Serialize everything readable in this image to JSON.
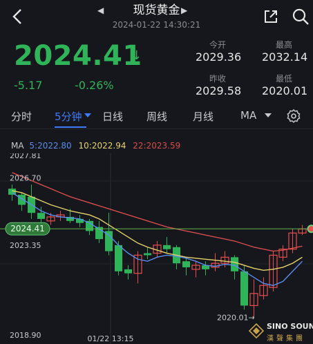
{
  "header": {
    "title": "现货黄金",
    "datetime": "2024-01-22 14:30:21",
    "back_icon": "chevron-left-icon",
    "share_icon": "share-icon",
    "search_icon": "search-icon"
  },
  "quote": {
    "price": "2024.41",
    "change": "-5.17",
    "change_pct": "-0.26%",
    "trend_icon": "down-arrow-icon",
    "open_label": "今开",
    "open": "2029.36",
    "high_label": "最高",
    "high": "2032.14",
    "prev_close_label": "昨收",
    "prev_close": "2029.58",
    "low_label": "最低",
    "low": "2020.01",
    "up_color": "#e84e4e",
    "down_color": "#2fb45a"
  },
  "tabs": [
    {
      "label": "分时",
      "active": false
    },
    {
      "label": "5分钟",
      "active": true
    },
    {
      "label": "日线",
      "active": false
    },
    {
      "label": "周线",
      "active": false
    },
    {
      "label": "月线",
      "active": false
    },
    {
      "label": "MA",
      "active": false
    }
  ],
  "settings_icon": "gear-icon",
  "ma_legend": {
    "label": "MA",
    "ma5": "5:2022.80",
    "ma10": "10:2022.94",
    "ma22": "22:2023.59",
    "ma5_color": "#5b8def",
    "ma10_color": "#e6d26b",
    "ma22_color": "#d64c4c"
  },
  "chart_data": {
    "type": "candlestick",
    "y_labels": [
      "2027.81",
      "2026.70",
      "2023.35",
      "2018.90"
    ],
    "x_label": "01/22 13:15",
    "current_price_tag": "2024.41",
    "low_annotation": "2020.01→",
    "ylim": [
      2018.9,
      2027.81
    ],
    "candles": [
      {
        "o": 2026.4,
        "c": 2026.1,
        "h": 2026.6,
        "l": 2025.8
      },
      {
        "o": 2026.1,
        "c": 2025.6,
        "h": 2026.2,
        "l": 2025.3
      },
      {
        "o": 2026.0,
        "c": 2025.2,
        "h": 2026.6,
        "l": 2024.9
      },
      {
        "o": 2025.2,
        "c": 2024.9,
        "h": 2025.5,
        "l": 2024.7
      },
      {
        "o": 2024.8,
        "c": 2025.0,
        "h": 2025.2,
        "l": 2024.6
      },
      {
        "o": 2025.0,
        "c": 2025.1,
        "h": 2025.3,
        "l": 2024.8
      },
      {
        "o": 2025.0,
        "c": 2024.8,
        "h": 2025.4,
        "l": 2024.7
      },
      {
        "o": 2024.9,
        "c": 2024.7,
        "h": 2025.1,
        "l": 2024.5
      },
      {
        "o": 2024.8,
        "c": 2024.3,
        "h": 2024.9,
        "l": 2024.1
      },
      {
        "o": 2024.5,
        "c": 2023.9,
        "h": 2024.8,
        "l": 2023.7
      },
      {
        "o": 2024.3,
        "c": 2023.3,
        "h": 2025.2,
        "l": 2023.1
      },
      {
        "o": 2023.6,
        "c": 2022.3,
        "h": 2023.8,
        "l": 2022.1
      },
      {
        "o": 2022.4,
        "c": 2022.2,
        "h": 2022.6,
        "l": 2021.9
      },
      {
        "o": 2022.2,
        "c": 2023.1,
        "h": 2023.3,
        "l": 2021.7
      },
      {
        "o": 2023.2,
        "c": 2023.1,
        "h": 2023.5,
        "l": 2022.9
      },
      {
        "o": 2023.2,
        "c": 2023.6,
        "h": 2023.8,
        "l": 2023.0
      },
      {
        "o": 2023.6,
        "c": 2023.4,
        "h": 2024.0,
        "l": 2023.2
      },
      {
        "o": 2023.5,
        "c": 2022.7,
        "h": 2023.6,
        "l": 2022.4
      },
      {
        "o": 2022.8,
        "c": 2022.5,
        "h": 2023.0,
        "l": 2022.1
      },
      {
        "o": 2022.4,
        "c": 2022.6,
        "h": 2022.8,
        "l": 2022.0
      },
      {
        "o": 2022.6,
        "c": 2022.4,
        "h": 2022.8,
        "l": 2022.1
      },
      {
        "o": 2022.5,
        "c": 2022.7,
        "h": 2023.2,
        "l": 2022.3
      },
      {
        "o": 2022.7,
        "c": 2023.0,
        "h": 2023.3,
        "l": 2022.5
      },
      {
        "o": 2023.0,
        "c": 2022.3,
        "h": 2023.1,
        "l": 2021.9
      },
      {
        "o": 2022.3,
        "c": 2020.6,
        "h": 2022.6,
        "l": 2020.4
      },
      {
        "o": 2020.6,
        "c": 2021.2,
        "h": 2021.9,
        "l": 2020.01
      },
      {
        "o": 2021.1,
        "c": 2021.6,
        "h": 2022.0,
        "l": 2020.9
      },
      {
        "o": 2021.5,
        "c": 2023.1,
        "h": 2023.3,
        "l": 2021.3
      },
      {
        "o": 2023.0,
        "c": 2023.4,
        "h": 2023.6,
        "l": 2022.8
      },
      {
        "o": 2023.4,
        "c": 2024.2,
        "h": 2024.4,
        "l": 2023.2
      },
      {
        "o": 2024.2,
        "c": 2024.4,
        "h": 2024.6,
        "l": 2024.1
      }
    ],
    "ma5": [
      2026.2,
      2025.9,
      2025.6,
      2025.3,
      2025.1,
      2025.0,
      2024.95,
      2024.9,
      2024.7,
      2024.4,
      2024.1,
      2023.6,
      2023.2,
      2022.9,
      2022.8,
      2023.0,
      2023.1,
      2023.05,
      2022.95,
      2022.8,
      2022.6,
      2022.55,
      2022.65,
      2022.6,
      2022.3,
      2022.0,
      2021.7,
      2021.6,
      2021.8,
      2022.3,
      2022.8
    ],
    "ma10": [
      2026.3,
      2026.2,
      2026.0,
      2025.8,
      2025.6,
      2025.45,
      2025.3,
      2025.2,
      2025.1,
      2024.9,
      2024.6,
      2024.3,
      2024.0,
      2023.7,
      2023.5,
      2023.35,
      2023.2,
      2023.1,
      2023.0,
      2022.95,
      2022.9,
      2022.85,
      2022.8,
      2022.75,
      2022.6,
      2022.45,
      2022.35,
      2022.4,
      2022.5,
      2022.7,
      2023.0
    ],
    "ma22": [
      2027.2,
      2027.0,
      2026.8,
      2026.6,
      2026.4,
      2026.2,
      2026.0,
      2025.85,
      2025.7,
      2025.55,
      2025.4,
      2025.25,
      2025.1,
      2024.95,
      2024.8,
      2024.65,
      2024.5,
      2024.4,
      2024.3,
      2024.2,
      2024.1,
      2024.0,
      2023.9,
      2023.8,
      2023.65,
      2023.5,
      2023.4,
      2023.3,
      2023.35,
      2023.45,
      2023.55
    ]
  },
  "brand": {
    "name": "SINO SOUND",
    "sub": "漢聲集團",
    "logo_icon": "sino-sound-logo-icon"
  }
}
